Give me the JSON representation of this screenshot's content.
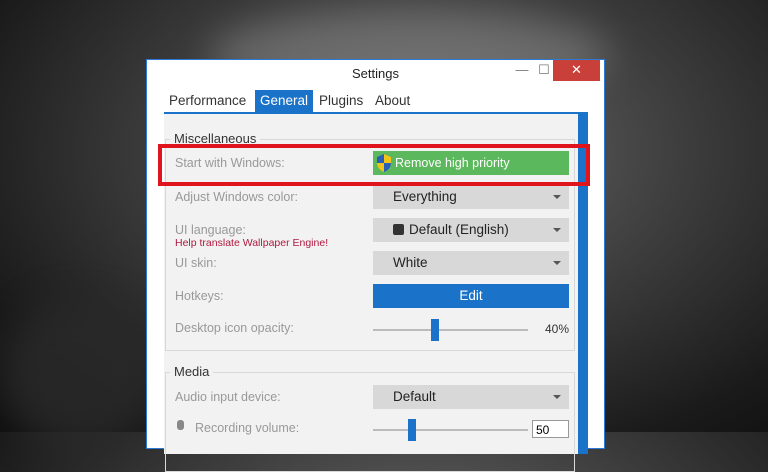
{
  "window": {
    "title": "Settings",
    "minimize": "—",
    "maximize": "☐",
    "close": "✕"
  },
  "tabs": [
    {
      "label": "Performance"
    },
    {
      "label": "General"
    },
    {
      "label": "Plugins"
    },
    {
      "label": "About"
    }
  ],
  "misc": {
    "group_label": "Miscellaneous",
    "start_label": "Start with Windows:",
    "start_button": "Remove high priority",
    "color_label": "Adjust Windows color:",
    "color_value": "Everything",
    "lang_label": "UI language:",
    "lang_link": "Help translate Wallpaper Engine!",
    "lang_value": "Default (English)",
    "skin_label": "UI skin:",
    "skin_value": "White",
    "hotkeys_label": "Hotkeys:",
    "hotkeys_button": "Edit",
    "opacity_label": "Desktop icon opacity:",
    "opacity_value": "40%",
    "opacity_fraction": 0.4
  },
  "media": {
    "group_label": "Media",
    "audio_label": "Audio input device:",
    "audio_value": "Default",
    "rec_label": "Recording volume:",
    "rec_value": "50",
    "rec_fraction": 0.25
  },
  "colors": {
    "accent": "#1a73c9",
    "green": "#5cb85c",
    "highlight": "#e0141c"
  },
  "icons": {
    "uac_shield": "shield-icon",
    "language": "language-icon",
    "microphone": "microphone-icon"
  }
}
